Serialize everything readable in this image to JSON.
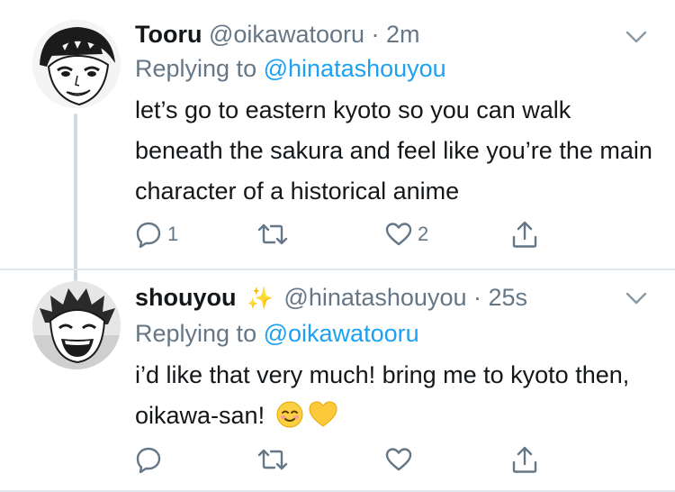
{
  "tweets": [
    {
      "display_name": "Tooru",
      "handle": "@oikawatooru",
      "separator": "·",
      "time": "2m",
      "replying_prefix": "Replying to",
      "replying_to": "@hinatashouyou",
      "text": "let’s go to eastern kyoto so you can walk beneath the sakura and feel like you’re the main character of a historical anime",
      "reply_count": "1",
      "retweet_count": "",
      "like_count": "2"
    },
    {
      "display_name": "shouyou",
      "emoji_after_name": "✨",
      "handle": "@hinatashouyou",
      "separator": "·",
      "time": "25s",
      "replying_prefix": "Replying to",
      "replying_to": "@oikawatooru",
      "text": "i’d like that very much! bring me to kyoto then, oikawa-san! ",
      "text_emojis": "☺️💛",
      "reply_count": "",
      "retweet_count": "",
      "like_count": ""
    }
  ],
  "colors": {
    "primary_text": "#14171a",
    "secondary_text": "#657786",
    "link": "#1da1f2",
    "divider": "#e1e8ed"
  },
  "icons": [
    "reply-icon",
    "retweet-icon",
    "like-icon",
    "share-icon",
    "chevron-down-icon"
  ]
}
